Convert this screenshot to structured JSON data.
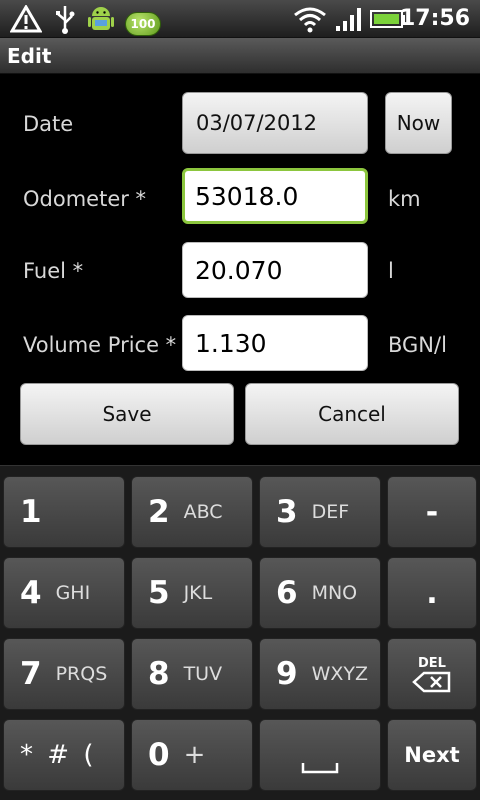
{
  "status_bar": {
    "time": "17:56",
    "battery_badge": "100",
    "icons": [
      "warning-icon",
      "usb-icon",
      "android-icon",
      "battery-badge-icon",
      "wifi-icon",
      "signal-icon",
      "battery-icon"
    ]
  },
  "title_bar": {
    "title": "Edit"
  },
  "form": {
    "date": {
      "label": "Date",
      "value": "03/07/2012",
      "now_button": "Now"
    },
    "odometer": {
      "label": "Odometer *",
      "value": "53018.0",
      "unit": "km"
    },
    "fuel": {
      "label": "Fuel *",
      "value": "20.070",
      "unit": "l"
    },
    "volume_price": {
      "label": "Volume Price *",
      "value": "1.130",
      "unit": "BGN/l"
    },
    "save_button": "Save",
    "cancel_button": "Cancel"
  },
  "keyboard": {
    "keys": [
      {
        "num": "1",
        "letters": ""
      },
      {
        "num": "2",
        "letters": "ABC"
      },
      {
        "num": "3",
        "letters": "DEF"
      },
      {
        "num": "-",
        "letters": ""
      },
      {
        "num": "4",
        "letters": "GHI"
      },
      {
        "num": "5",
        "letters": "JKL"
      },
      {
        "num": "6",
        "letters": "MNO"
      },
      {
        "num": ".",
        "letters": ""
      },
      {
        "num": "7",
        "letters": "PRQS"
      },
      {
        "num": "8",
        "letters": "TUV"
      },
      {
        "num": "9",
        "letters": "WXYZ"
      },
      {
        "num": "DEL",
        "letters": ""
      },
      {
        "num": "* # (",
        "letters": ""
      },
      {
        "num": "0",
        "letters": "+"
      },
      {
        "num": "",
        "letters": ""
      },
      {
        "num": "Next",
        "letters": ""
      }
    ]
  },
  "colors": {
    "focus_border": "#8cc63e",
    "background": "#000000"
  }
}
